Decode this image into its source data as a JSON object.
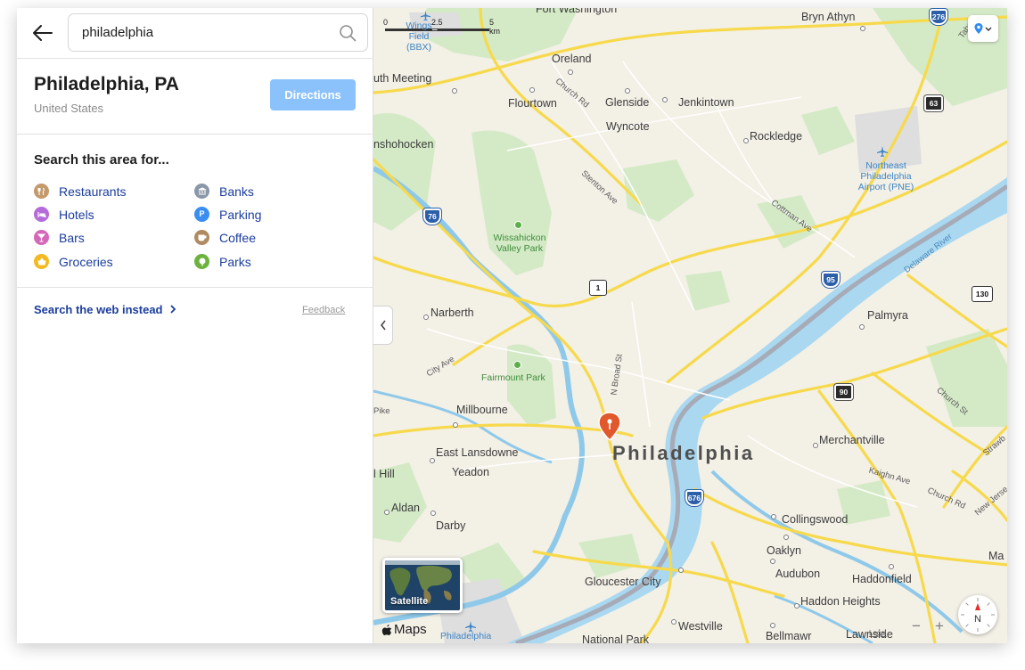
{
  "search": {
    "query": "philadelphia",
    "back_icon": "arrow-left-icon",
    "search_icon": "magnifying-glass-icon"
  },
  "place": {
    "title": "Philadelphia, PA",
    "subtitle": "United States",
    "directions_label": "Directions"
  },
  "categories": {
    "title": "Search this area for...",
    "items": [
      {
        "label": "Restaurants",
        "icon": "fork-knife-icon",
        "color": "#c49a6c"
      },
      {
        "label": "Hotels",
        "icon": "bed-icon",
        "color": "#b56bd9"
      },
      {
        "label": "Bars",
        "icon": "cocktail-icon",
        "color": "#d468b8"
      },
      {
        "label": "Groceries",
        "icon": "basket-icon",
        "color": "#f2b922"
      },
      {
        "label": "Banks",
        "icon": "bank-icon",
        "color": "#8a97a8"
      },
      {
        "label": "Parking",
        "icon": "parking-icon",
        "color": "#3a8ef0"
      },
      {
        "label": "Coffee",
        "icon": "coffee-icon",
        "color": "#b08a61"
      },
      {
        "label": "Parks",
        "icon": "tree-icon",
        "color": "#6bb33d"
      }
    ]
  },
  "links": {
    "web_search": "Search the web instead",
    "feedback": "Feedback"
  },
  "map": {
    "scale_labels": [
      "0",
      "2.5",
      "5 km"
    ],
    "city_label": "Philadelphia",
    "places": [
      "Fort Washington",
      "Bryn Athyn",
      "Oreland",
      "uth Meeting",
      "Flourtown",
      "Glenside",
      "Jenkintown",
      "Wyncote",
      "Rockledge",
      "nshohocken",
      "Narberth",
      "Palmyra",
      "Millbourne",
      "East Lansdowne",
      "Yeadon",
      "l Hill",
      "Aldan",
      "Darby",
      "Merchantville",
      "Collingswood",
      "Oaklyn",
      "Audubon",
      "Haddonfield",
      "Haddon Heights",
      "Gloucester City",
      "Westville",
      "Bellmawr",
      "National Park",
      "Lawnside",
      "Ma"
    ],
    "parks": [
      "Wissahickon Valley Park",
      "Fairmount Park"
    ],
    "airports": [
      "Wings Field (BBX)",
      "Northeast Philadelphia Airport (PNE)",
      "Philadelphia"
    ],
    "streets": [
      "Church Rd",
      "Stenton Ave",
      "Cottman Ave",
      "City Ave",
      "N Broad St",
      "Delaware River",
      "Church St",
      "Kaighn Ave",
      "Church Rd",
      "Pike",
      "New Jerse",
      "Strawb",
      "Tabor"
    ],
    "highways": {
      "interstate": [
        "276",
        "76",
        "95",
        "676"
      ],
      "us": [
        "1",
        "130"
      ],
      "state": [
        "63",
        "90"
      ]
    },
    "satellite_label": "Satellite",
    "brand": "Maps",
    "legal": "Legal",
    "zoom_out": "−",
    "zoom_in": "+",
    "compass_label": "N",
    "pin_icon": "location-pin-icon",
    "tracking_icon": "location-tracking-icon",
    "collapse_icon": "chevron-left-icon",
    "colors": {
      "land": "#f3f0e6",
      "park": "#d4eac6",
      "water": "#a9d8f0",
      "river": "#8fc9ea",
      "highway": "#f7d94c",
      "pin": "#e0582b"
    }
  }
}
